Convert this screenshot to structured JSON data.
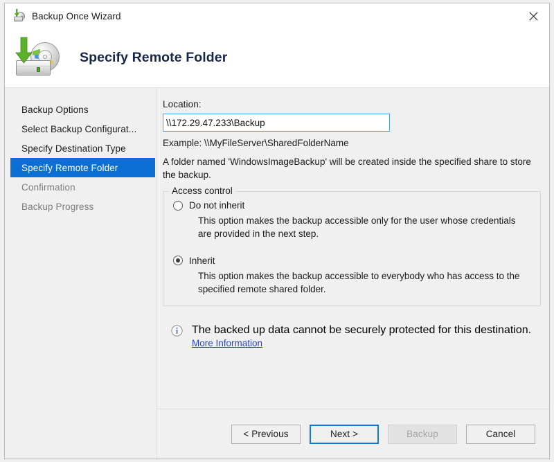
{
  "window": {
    "title": "Backup Once Wizard",
    "title_icon": "backup-disc-icon",
    "close_icon": "close-icon"
  },
  "header": {
    "title": "Specify Remote Folder",
    "icon": "backup-to-disc-icon"
  },
  "sidebar": {
    "items": [
      {
        "label": "Backup Options",
        "state": "normal"
      },
      {
        "label": "Select Backup Configurat...",
        "state": "normal"
      },
      {
        "label": "Specify Destination Type",
        "state": "normal"
      },
      {
        "label": "Specify Remote Folder",
        "state": "active"
      },
      {
        "label": "Confirmation",
        "state": "dim"
      },
      {
        "label": "Backup Progress",
        "state": "dim"
      }
    ]
  },
  "main": {
    "location_label": "Location:",
    "location_value": "\\\\172.29.47.233\\Backup",
    "location_placeholder": "",
    "example_text": "Example: \\\\MyFileServer\\SharedFolderName",
    "folder_note": "A folder named 'WindowsImageBackup' will be created inside the specified share to store the backup.",
    "access_control": {
      "title": "Access control",
      "options": [
        {
          "label": "Do not inherit",
          "selected": false,
          "description": "This option makes the backup accessible only for the user whose credentials are provided in the next step."
        },
        {
          "label": "Inherit",
          "selected": true,
          "description": "This option makes the backup accessible to everybody who has access to the specified remote shared folder."
        }
      ]
    },
    "info": {
      "icon": "info-icon",
      "message": "The backed up data cannot be securely protected for this destination.",
      "link_label": "More Information"
    }
  },
  "footer": {
    "buttons": [
      {
        "label": "< Previous",
        "state": "normal"
      },
      {
        "label": "Next >",
        "state": "default"
      },
      {
        "label": "Backup",
        "state": "disabled"
      },
      {
        "label": "Cancel",
        "state": "normal"
      }
    ]
  },
  "colors": {
    "accent": "#0b6fd4",
    "default_button_border": "#1277d4",
    "link": "#2b45c4",
    "header_title": "#16264a",
    "window_bg": "#f0f0f0"
  }
}
